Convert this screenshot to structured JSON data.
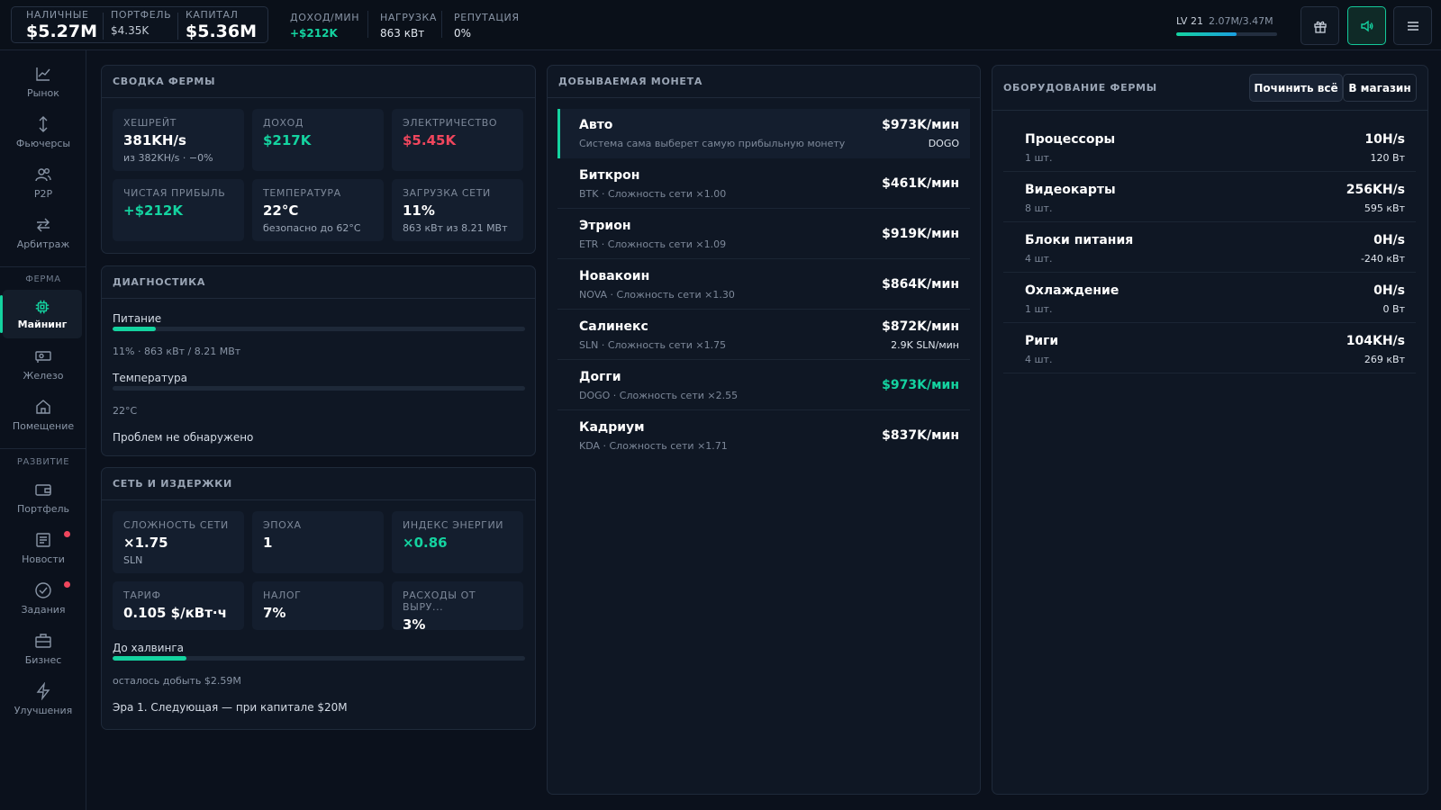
{
  "topbar": {
    "cash_label": "НАЛИЧНЫЕ",
    "cash_value": "$5.27M",
    "portfolio_label": "ПОРТФЕЛЬ",
    "portfolio_value": "$4.35K",
    "capital_label": "КАПИТАЛ",
    "capital_value": "$5.36M",
    "income_label": "ДОХОД/МИН",
    "income_value": "+$212K",
    "load_label": "НАГРУЗКА",
    "load_value": "863 кВт",
    "rep_label": "РЕПУТАЦИЯ",
    "rep_value": "0%",
    "level": "LV 21",
    "xp": "2.07M/3.47M",
    "xp_progress": 0.6,
    "buttons": [
      "gift-icon",
      "volume-icon",
      "menu-icon"
    ]
  },
  "sidebar": {
    "items_top": [
      {
        "label": "Рынок",
        "icon": "chart-line-icon"
      },
      {
        "label": "Фьючерсы",
        "icon": "arrows-vertical-icon"
      },
      {
        "label": "P2P",
        "icon": "users-icon"
      },
      {
        "label": "Арбитраж",
        "icon": "arrows-swap-icon"
      }
    ],
    "section_farm": "ФЕРМА",
    "items_farm": [
      {
        "label": "Майнинг",
        "icon": "cpu-icon",
        "active": true
      },
      {
        "label": "Железо",
        "icon": "gpu-icon"
      },
      {
        "label": "Помещение",
        "icon": "home-icon"
      }
    ],
    "section_dev": "РАЗВИТИЕ",
    "items_dev": [
      {
        "label": "Портфель",
        "icon": "wallet-icon"
      },
      {
        "label": "Новости",
        "icon": "news-icon",
        "badge": true
      },
      {
        "label": "Задания",
        "icon": "check-circle-icon",
        "badge": true
      },
      {
        "label": "Бизнес",
        "icon": "briefcase-icon"
      },
      {
        "label": "Улучшения",
        "icon": "bolt-icon"
      }
    ],
    "accent": "#14d3a0"
  },
  "summary": {
    "title": "СВОДКА ФЕРМЫ",
    "cards": [
      {
        "label": "ХЕШРЕЙТ",
        "value": "381KH/s",
        "sub": "из 382KH/s · −0%"
      },
      {
        "label": "ДОХОД",
        "value": "$217K",
        "sub": ""
      },
      {
        "label": "ЭЛЕКТРИЧЕСТВО",
        "value": "$5.45K",
        "sub": ""
      },
      {
        "label": "ЧИСТАЯ ПРИБЫЛЬ",
        "value": "+$212K",
        "sub": ""
      },
      {
        "label": "ТЕМПЕРАТУРА",
        "value": "22°C",
        "sub": "безопасно до 62°C"
      },
      {
        "label": "ЗАГРУЗКА СЕТИ",
        "value": "11%",
        "sub": "863 кВт из 8.21 МВт"
      }
    ]
  },
  "diagnostics": {
    "title": "ДИАГНОСТИКА",
    "power_label": "Питание",
    "power_progress": 0.105,
    "power_detail": "11% · 863 кВт / 8.21 МВт",
    "temp_label": "Температура",
    "temp_progress": 0.0,
    "temp_detail": "22°C",
    "status": "Проблем не обнаружено"
  },
  "network": {
    "title": "СЕТЬ И ИЗДЕРЖКИ",
    "cards": [
      {
        "label": "СЛОЖНОСТЬ СЕТИ",
        "value": "×1.75",
        "sub": "SLN"
      },
      {
        "label": "ЭПОХА",
        "value": "1",
        "sub": ""
      },
      {
        "label": "ИНДЕКС ЭНЕРГИИ",
        "value": "×0.86",
        "sub": ""
      },
      {
        "label": "ТАРИФ",
        "value": "0.105 $/кВт·ч",
        "sub": ""
      },
      {
        "label": "НАЛОГ",
        "value": "7%",
        "sub": ""
      },
      {
        "label": "РАСХОДЫ ОТ ВЫРУ...",
        "value": "3%",
        "sub": ""
      }
    ],
    "halving_label": "До халвинга",
    "halving_progress": 0.18,
    "halving_remaining": "осталось добыть $2.59M",
    "era_text": "Эра 1. Следующая — при капитале $20M"
  },
  "coins": {
    "title": "ДОБЫВАЕМАЯ МОНЕТА",
    "list": [
      {
        "name": "Авто",
        "sub": "Система сама выберет самую прибыльную монету",
        "rate": "$973K/мин",
        "extra": "DOGO",
        "selected": true
      },
      {
        "name": "Биткрон",
        "sub": "BTK · Сложность сети ×1.00",
        "rate": "$461K/мин",
        "extra": ""
      },
      {
        "name": "Этрион",
        "sub": "ETR · Сложность сети ×1.09",
        "rate": "$919K/мин",
        "extra": ""
      },
      {
        "name": "Новакоин",
        "sub": "NOVA · Сложность сети ×1.30",
        "rate": "$864K/мин",
        "extra": ""
      },
      {
        "name": "Салинекс",
        "sub": "SLN · Сложность сети ×1.75",
        "rate": "$872K/мин",
        "extra": "2.9K SLN/мин"
      },
      {
        "name": "Догги",
        "sub": "DOGO · Сложность сети ×2.55",
        "rate": "$973K/мин",
        "extra": "",
        "best": true
      },
      {
        "name": "Кадриум",
        "sub": "KDA · Сложность сети ×1.71",
        "rate": "$837K/мин",
        "extra": ""
      }
    ]
  },
  "equipment": {
    "title": "ОБОРУДОВАНИЕ ФЕРМЫ",
    "repair_label": "Починить всё",
    "shop_label": "В магазин",
    "list": [
      {
        "name": "Процессоры",
        "qty": "1 шт.",
        "hash": "10H/s",
        "power": "120 Вт"
      },
      {
        "name": "Видеокарты",
        "qty": "8 шт.",
        "hash": "256KH/s",
        "power": "595 кВт"
      },
      {
        "name": "Блоки питания",
        "qty": "4 шт.",
        "hash": "0H/s",
        "power": "-240 кВт"
      },
      {
        "name": "Охлаждение",
        "qty": "1 шт.",
        "hash": "0H/s",
        "power": "0 Вт"
      },
      {
        "name": "Риги",
        "qty": "4 шт.",
        "hash": "104KH/s",
        "power": "269 кВт"
      }
    ]
  }
}
